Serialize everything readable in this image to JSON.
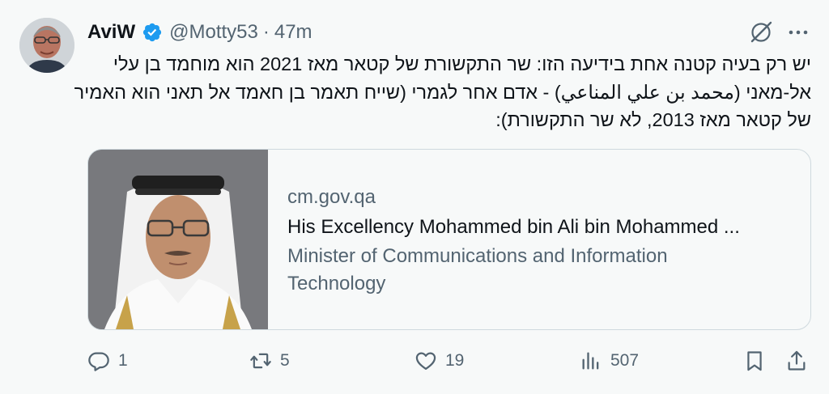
{
  "author": {
    "name": "AviW",
    "handle": "@Motty53",
    "separator": "·",
    "time": "47m"
  },
  "tweet": {
    "lines": [
      "יש רק בעיה קטנה אחת בידיעה הזו: שר התקשורת של קטאר מאז 2021 הוא מוחמד בן עלי",
      "אל-מאני (محمد بن علي المناعي) - אדם אחר לגמרי (שייח תאמר בן חאמד אל תאני הוא האמיר",
      "של קטאר מאז 2013, לא שר התקשורת):"
    ]
  },
  "card": {
    "domain": "cm.gov.qa",
    "title": "His Excellency Mohammed bin Ali bin Mohammed ...",
    "description_lines": [
      "Minister of Communications and Information",
      "Technology"
    ]
  },
  "actions": {
    "replies": "1",
    "retweets": "5",
    "likes": "19",
    "views": "507"
  },
  "icons": [
    "verified-badge-icon",
    "grok-icon",
    "more-icon",
    "reply-icon",
    "retweet-icon",
    "like-icon",
    "views-icon",
    "bookmark-icon",
    "share-icon"
  ],
  "colors": {
    "accent": "#1d9bf0",
    "muted": "#536471",
    "text": "#0f1419"
  }
}
